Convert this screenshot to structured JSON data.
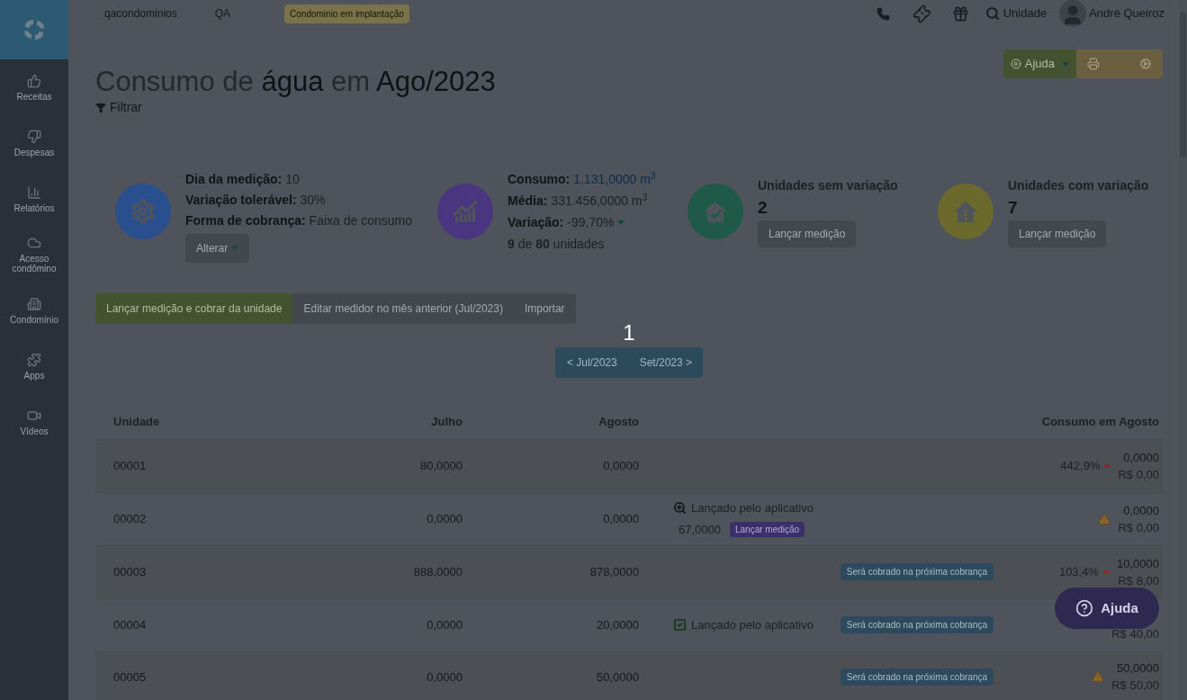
{
  "sidebar": {
    "items": [
      {
        "label": "Receitas"
      },
      {
        "label": "Despesas"
      },
      {
        "label": "Relatórios"
      },
      {
        "label": "Acesso condômino"
      },
      {
        "label": "Condomínio"
      },
      {
        "label": "Apps"
      },
      {
        "label": "Vídeos"
      }
    ]
  },
  "topbar": {
    "account": "qacondominios",
    "environment": "QA",
    "badge": "Condominio em implantação",
    "search": "Unidade",
    "user": "André Queiroz"
  },
  "title": [
    {
      "text": "Consumo de",
      "strong": false
    },
    {
      "text": "água",
      "strong": true
    },
    {
      "text": "em",
      "strong": false
    },
    {
      "text": "Ago/2023",
      "strong": true
    }
  ],
  "filter": "Filtrar",
  "help_button": "Ajuda",
  "settings": {
    "items": [
      {
        "label": "Dia da medição:",
        "value": "10"
      },
      {
        "label": "Variação tolerável:",
        "value": "30%"
      },
      {
        "label": "Forma de cobrança:",
        "value": "Faixa de consumo"
      }
    ],
    "button": "Alterar"
  },
  "summary": {
    "items": [
      {
        "label": "Consumo:",
        "value": "1.131,0000 m$^{3}$",
        "link": true
      },
      {
        "label": "Média:",
        "value": "331.456,0000 m$^{3}$",
        "link": false
      },
      {
        "label": "Variação:",
        "value": "-99,70%",
        "link": false
      }
    ],
    "units": "**9** de **80** unidades"
  },
  "stats": [
    {
      "kind": "ok",
      "title": "Unidades sem variação",
      "count": "2",
      "button": "Lançar medição"
    },
    {
      "kind": "warning",
      "title": "Unidades com variação",
      "count": "7",
      "button": "Lançar medição"
    }
  ],
  "tabs": [
    {
      "label": "Lançar medição e cobrar da unidade",
      "selected": true
    },
    {
      "label": "Editar medidor no mês anterior (Jul/2023)",
      "selected": false
    },
    {
      "label": "Importar",
      "selected": false
    }
  ],
  "step_marker": "1",
  "pager": {
    "previous": "< Jul/2023",
    "next": "Set/2023 >"
  },
  "table": {
    "columns": [
      "Unidade",
      "Julho",
      "Agosto",
      "Consumo em Agosto"
    ],
    "rows": [
      {
        "unit": "00001",
        "july": "80,0000",
        "august": "0,0000",
        "variation": "442,9%",
        "consumption": "0,0000",
        "amount": "R$ 0,00",
        "warning": false
      },
      {
        "unit": "00002",
        "july": "0,0000",
        "august": "0,0000",
        "note": {
          "kind": "review",
          "text": "Lançado pelo aplicativo",
          "reading": "67,0000",
          "action": "Lançar medição"
        },
        "consumption": "0,0000",
        "amount": "R$ 0,00",
        "warning": true
      },
      {
        "unit": "00003",
        "july": "888,0000",
        "august": "878,0000",
        "tag": "Será cobrado na próxima cobrança",
        "variation": "103,4%",
        "consumption": "10,0000",
        "amount": "R$ 8,00",
        "warning": false
      },
      {
        "unit": "00004",
        "july": "0,0000",
        "august": "20,0000",
        "note": {
          "kind": "confirmed",
          "text": "Lançado pelo aplicativo"
        },
        "tag": "Será cobrado na próxima cobrança",
        "amount": "R$ 40,00",
        "warning": false
      },
      {
        "unit": "00005",
        "july": "0,0000",
        "august": "50,0000",
        "tag": "Será cobrado na próxima cobrança",
        "consumption": "50,0000",
        "amount": "R$ 50,00",
        "warning": true
      }
    ]
  },
  "floating_help": "Ajuda"
}
